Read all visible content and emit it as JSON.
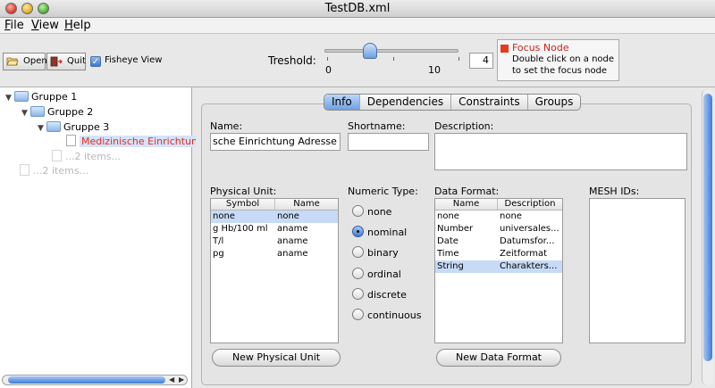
{
  "window": {
    "title": "TestDB.xml"
  },
  "menu": [
    {
      "first": "F",
      "rest": "ile"
    },
    {
      "first": "V",
      "rest": "iew"
    },
    {
      "first": "H",
      "rest": "elp"
    }
  ],
  "toolbar": {
    "open_label": "Open",
    "quit_label": "Quit",
    "fisheye_label": "Fisheye View",
    "fisheye_checked": true,
    "treshold_label": "Treshold:",
    "slider_min": "0",
    "slider_max": "10",
    "treshold_value": "4",
    "focus_title": "Focus Node",
    "focus_hint_1": "Double click on a node",
    "focus_hint_2": "to set the focus node",
    "focus_color": "#e8391d"
  },
  "tree": {
    "nodes": [
      {
        "label": "Gruppe 1"
      },
      {
        "label": "Gruppe 2"
      },
      {
        "label": "Gruppe 3"
      },
      {
        "label": "Medizinische Einrichtung"
      },
      {
        "label": "...2 items..."
      },
      {
        "label": "...2 items..."
      }
    ]
  },
  "tabs": [
    {
      "label": "Info",
      "active": true
    },
    {
      "label": "Dependencies"
    },
    {
      "label": "Constraints"
    },
    {
      "label": "Groups"
    }
  ],
  "form": {
    "name_label": "Name:",
    "name_value": "sche Einrichtung Adresse",
    "shortname_label": "Shortname:",
    "shortname_value": "",
    "description_label": "Description:",
    "description_value": "",
    "physical_unit_label": "Physical Unit:",
    "physical_unit_columns": [
      "Symbol",
      "Name"
    ],
    "physical_units": [
      [
        "none",
        "none"
      ],
      [
        "g Hb/100 ml",
        "aname"
      ],
      [
        "T/l",
        "aname"
      ],
      [
        "pg",
        "aname"
      ]
    ],
    "numeric_type_label": "Numeric Type:",
    "numeric_types": [
      "none",
      "nominal",
      "binary",
      "ordinal",
      "discrete",
      "continuous"
    ],
    "numeric_type_selected": "nominal",
    "data_format_label": "Data Format:",
    "data_format_columns": [
      "Name",
      "Description"
    ],
    "data_formats": [
      [
        "none",
        "none"
      ],
      [
        "Number",
        "universales..."
      ],
      [
        "Date",
        "Datumsfor..."
      ],
      [
        "Time",
        "Zeitformat"
      ],
      [
        "String",
        "Charakters..."
      ]
    ],
    "mesh_label": "MESH IDs:",
    "new_unit_button": "New Physical Unit",
    "new_format_button": "New Data Format"
  }
}
